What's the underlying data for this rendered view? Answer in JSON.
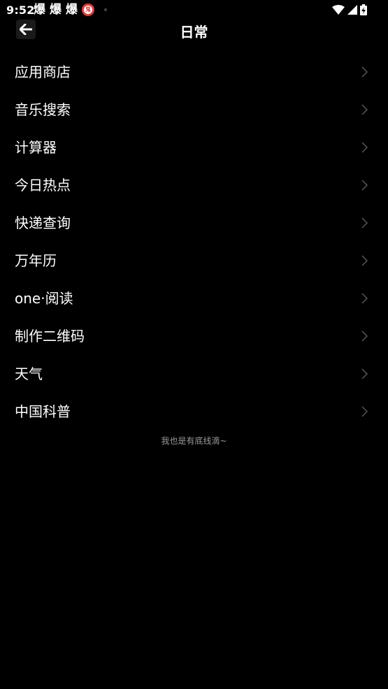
{
  "status_bar": {
    "time": "9:52",
    "notification_icons": [
      "爆",
      "爆",
      "爆"
    ],
    "badge_text": "鬼",
    "system_icons": [
      "wifi-icon",
      "signal-icon",
      "battery-charging-icon"
    ]
  },
  "header": {
    "title": "日常",
    "back_icon": "arrow-left-icon"
  },
  "menu": {
    "items": [
      {
        "label": "应用商店"
      },
      {
        "label": "音乐搜索"
      },
      {
        "label": "计算器"
      },
      {
        "label": "今日热点"
      },
      {
        "label": "快递查询"
      },
      {
        "label": "万年历"
      },
      {
        "label": "one·阅读"
      },
      {
        "label": "制作二维码"
      },
      {
        "label": "天气"
      },
      {
        "label": "中国科普"
      }
    ],
    "chevron_icon": "chevron-right-icon"
  },
  "footer": {
    "text": "我也是有底线滴~"
  },
  "colors": {
    "background": "#000000",
    "text_primary": "#ffffff",
    "text_secondary": "#9a9a9a",
    "chevron": "#555555",
    "badge": "#e83a3a"
  }
}
